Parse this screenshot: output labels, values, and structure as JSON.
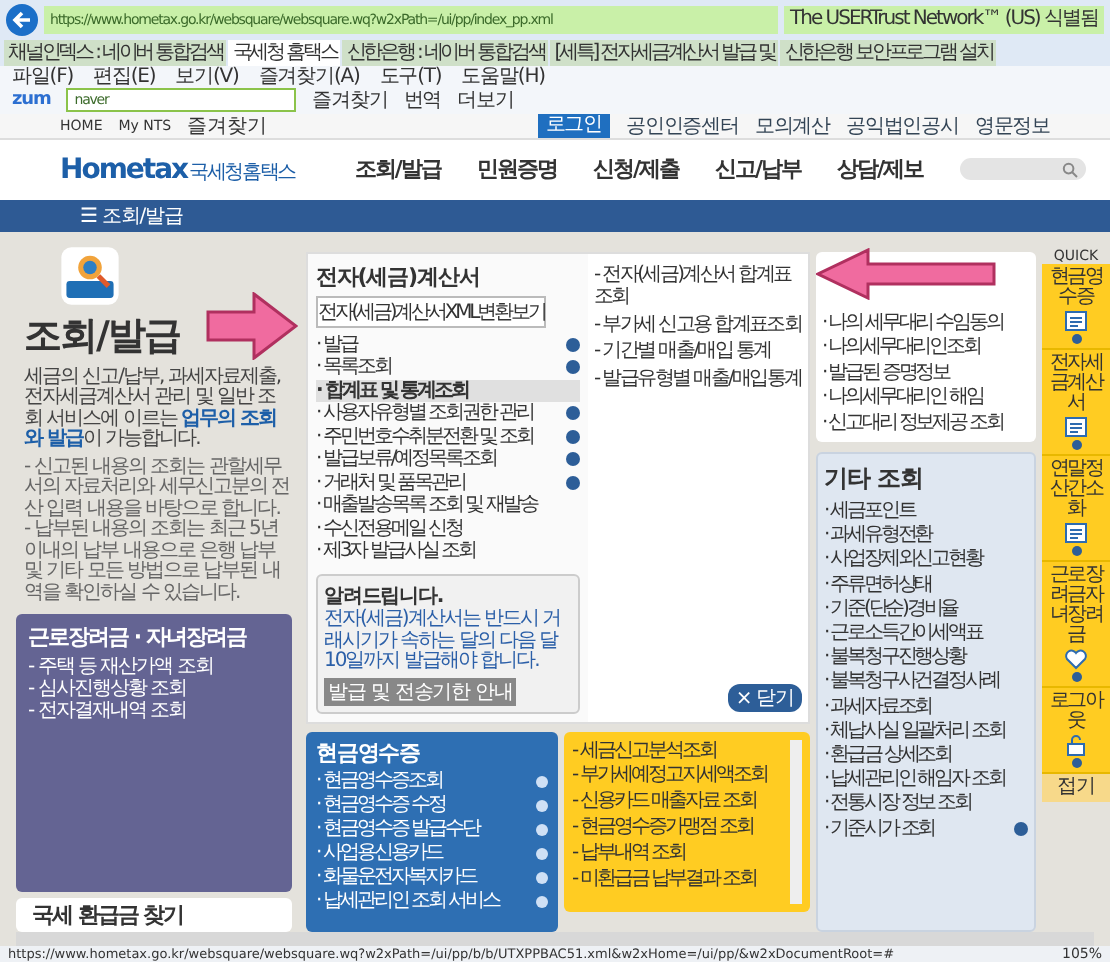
{
  "browser": {
    "url": "https://www.hometax.go.kr/websquare/websquare.wq?w2xPath=/ui/pp/index_pp.xml",
    "security": "The USERTrust Network™ (US) 식별됨",
    "tabs": [
      {
        "label": "채널인덱스 : 네이버 통합검색",
        "selected": false
      },
      {
        "label": "국세청 홈택스",
        "selected": true
      },
      {
        "label": "신한은행 : 네이버 통합검색",
        "selected": false
      },
      {
        "label": "[세특] 전자세금계산서 발급 및",
        "selected": false
      },
      {
        "label": "신한은행 보안프로그램 설치",
        "selected": false
      }
    ],
    "menu": [
      "파일(F)",
      "편집(E)",
      "보기(V)",
      "즐겨찾기(A)",
      "도구(T)",
      "도움말(H)"
    ],
    "toolbar": {
      "logo": "zum",
      "search_value": "naver",
      "items": [
        "즐겨찾기",
        "번역",
        "더보기"
      ]
    }
  },
  "site_topbar": {
    "left": [
      "HOME",
      "My NTS",
      "즐겨찾기"
    ],
    "login": "로그인",
    "links": [
      "공인인증센터",
      "모의계산",
      "공익법인공시",
      "영문정보"
    ]
  },
  "header": {
    "logo": "Hometax",
    "logo_sub": "국세청홈택스",
    "nav": [
      "조회/발급",
      "민원증명",
      "신청/제출",
      "신고/납부",
      "상담/제보"
    ]
  },
  "section_bar": {
    "icon": "☰",
    "label": "조회/발급"
  },
  "intro": {
    "title": "조회/발급",
    "description": "세금의 신고/납부, 과세자료제출, 전자세금계산서 관리 및 일반 조회 서비스에 이르는 **업무의 조회와 발급**이 가능합니다.",
    "notes": [
      "- 신고된 내용의 조회는 관할세무서의 자료처리와 세무신고분의 전산 입력 내용을 바탕으로 합니다.",
      "- 납부된 내용의 조회는 최근 5년 이내의 납부 내용으로 은행 납부 및 기타 모든 방법으로 납부된 내역을 확인하실 수 있습니다."
    ]
  },
  "incentive_box": {
    "title": "근로장려금 · 자녀장려금",
    "items": [
      "- 주택 등 재산가액 조회",
      "- 심사진행상황 조회",
      "- 전자결재내역 조회"
    ]
  },
  "refund_box": {
    "title": "국세 환급금 찾기"
  },
  "invoice_panel": {
    "title": "전자(세금)계산서",
    "xml_button": "전자(세금)계산서XML변환보기",
    "items": [
      {
        "label": "· 발급",
        "selected": false,
        "has_icon": true
      },
      {
        "label": "· 목록조회",
        "selected": false,
        "has_icon": true
      },
      {
        "label": "· 합계표 및 통계조회",
        "selected": true,
        "has_icon": false
      },
      {
        "label": "· 사용자유형별 조회권한 관리",
        "selected": false,
        "has_icon": true
      },
      {
        "label": "· 주민번호수취분전환 및 조회",
        "selected": false,
        "has_icon": true
      },
      {
        "label": "· 발급보류/예정목록조회",
        "selected": false,
        "has_icon": true
      },
      {
        "label": "· 거래처 및 품목관리",
        "selected": false,
        "has_icon": true
      },
      {
        "label": "· 매출발송목록 조회 및 재발송",
        "selected": false,
        "has_icon": false
      },
      {
        "label": "· 수신전용메일 신청",
        "selected": false,
        "has_icon": false
      },
      {
        "label": "· 제3자 발급사실 조회",
        "selected": false,
        "has_icon": false
      }
    ],
    "subitems": [
      "- 전자(세금)계산서 합계표조회",
      "- 부가세 신고용 합계표조회",
      "- 기간별 매출/매입 통계",
      "- 발급유형별 매출/매입통계"
    ],
    "notice": {
      "title": "알려드립니다.",
      "text": "전자(세금)계산서는 반드시 거래시기가 속하는 달의 다음 달 10일까지 발급해야 합니다.",
      "button": "발급 및 전송기한 안내"
    },
    "close_button": "× 닫기"
  },
  "cash_receipt": {
    "title": "현금영수증",
    "items": [
      "· 현금영수증조회",
      "· 현금영수증 수정",
      "· 현금영수증 발급수단",
      "· 사업용신용카드",
      "· 화물운전자복지카드",
      "· 납세관리인 조회 서비스"
    ]
  },
  "yellow_list": {
    "items": [
      "- 세금신고분석조회",
      "- 부가세예정고지세액조회",
      "- 신용카드 매출자료 조회",
      "- 현금영수증가맹점 조회",
      "- 납부내역 조회",
      "- 미환급금 납부결과 조회"
    ]
  },
  "agent_card": {
    "items": [
      "· 나의 세무대리 수임동의",
      "· 나의세무대리인조회",
      "· 발급된 증명정보",
      "· 나의세무대리인 해임",
      "· 신고대리 정보제공 조회"
    ]
  },
  "other_lookup": {
    "title": "기타 조회",
    "items": [
      {
        "label": "· 세금포인트",
        "has_icon": false
      },
      {
        "label": "· 과세유형전환",
        "has_icon": false
      },
      {
        "label": "· 사업장제외신고현황",
        "has_icon": false
      },
      {
        "label": "· 주류면허상태",
        "has_icon": false
      },
      {
        "label": "· 기준(단순)경비율",
        "has_icon": false
      },
      {
        "label": "· 근로소득간이세액표",
        "has_icon": false
      },
      {
        "label": "· 불복청구진행상황",
        "has_icon": false
      },
      {
        "label": "· 불복청구사건결정사례",
        "has_icon": false
      },
      {
        "label": "· 과세자료조회",
        "has_icon": false
      },
      {
        "label": "· 체납사실 일괄처리 조회",
        "has_icon": false
      },
      {
        "label": "· 환급금 상세조회",
        "has_icon": false
      },
      {
        "label": "· 납세관리인 해임자 조회",
        "has_icon": false
      },
      {
        "label": "· 전통시장 정보 조회",
        "has_icon": false
      },
      {
        "label": "· 기준시가 조회",
        "has_icon": true
      }
    ]
  },
  "quick_menu": {
    "title": "QUICK",
    "items": [
      {
        "label": "현금영수증",
        "kind": "receipt"
      },
      {
        "label": "전자세금계산서",
        "kind": "invoice"
      },
      {
        "label": "연말정산간소화",
        "kind": "document"
      },
      {
        "label": "근로장려금자녀장려금",
        "kind": "heart"
      },
      {
        "label": "로그아웃",
        "kind": "lock"
      }
    ],
    "fold": "접기"
  },
  "status_bar": {
    "url": "https://www.hometax.go.kr/websquare/websquare.wq?w2xPath=/ui/pp/b/b/UTXPPBAC51.xml&w2xHome=/ui/pp/&w2xDocumentRoot=#",
    "zoom": "105%"
  }
}
